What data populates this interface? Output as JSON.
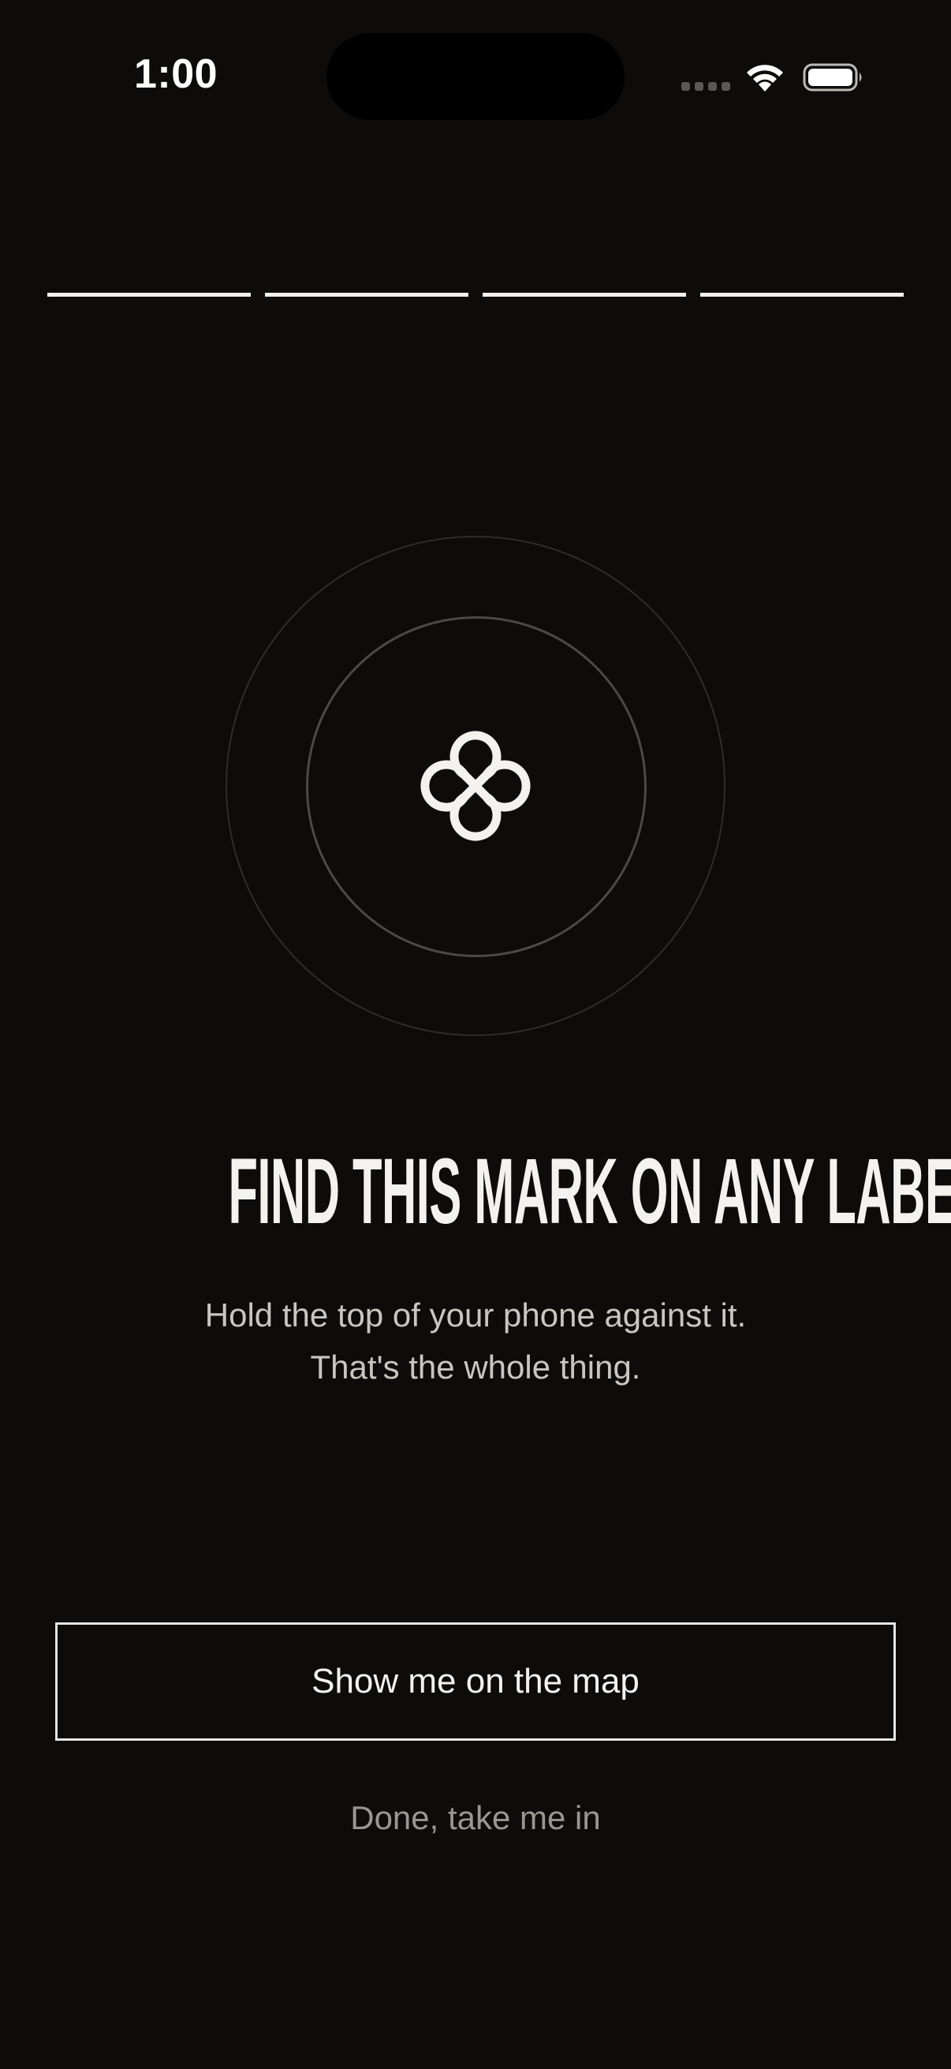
{
  "status_bar": {
    "time": "1:00"
  },
  "progress": {
    "total_steps": 4,
    "completed_steps": 4
  },
  "mark": {
    "icon": "loop-cross-mark-icon"
  },
  "onboarding": {
    "headline": "FIND THIS MARK ON ANY LABEL",
    "subtext_line1": "Hold the top of your phone against it.",
    "subtext_line2": "That's the whole thing."
  },
  "actions": {
    "primary_label": "Show me on the map",
    "secondary_label": "Done, take me in"
  },
  "colors": {
    "background": "#0d0c0b",
    "foreground": "#f2f0ec",
    "muted": "#9a9792"
  }
}
